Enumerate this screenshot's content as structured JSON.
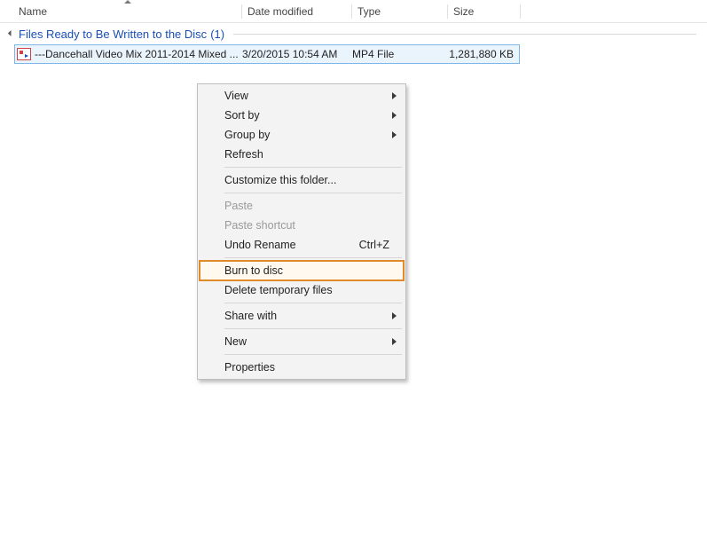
{
  "columns": {
    "name": "Name",
    "date": "Date modified",
    "type": "Type",
    "size": "Size"
  },
  "group": {
    "title": "Files Ready to Be Written to the Disc",
    "count": "(1)"
  },
  "file": {
    "name": "---Dancehall Video Mix 2011-2014 Mixed ...",
    "date": "3/20/2015 10:54 AM",
    "type": "MP4 File",
    "size": "1,281,880 KB"
  },
  "menu": {
    "view": "View",
    "sort_by": "Sort by",
    "group_by": "Group by",
    "refresh": "Refresh",
    "customize": "Customize this folder...",
    "paste": "Paste",
    "paste_shortcut": "Paste shortcut",
    "undo_rename": "Undo Rename",
    "undo_shortcut": "Ctrl+Z",
    "burn": "Burn to disc",
    "delete_temp": "Delete temporary files",
    "share_with": "Share with",
    "new": "New",
    "properties": "Properties"
  }
}
